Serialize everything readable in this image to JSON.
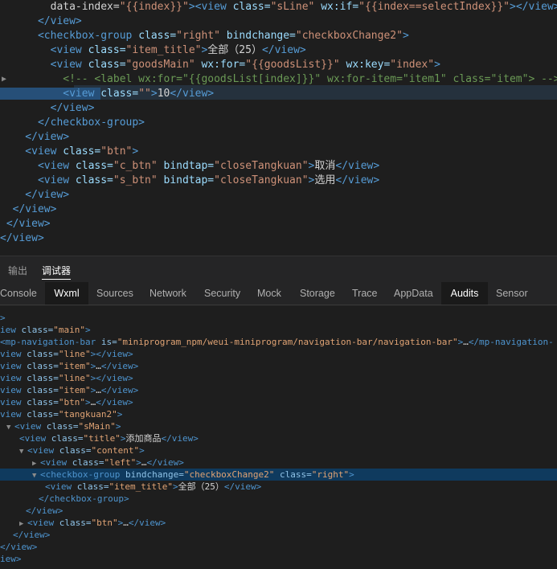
{
  "editor": {
    "lines": [
      [
        [
          "txt",
          "        data-index="
        ],
        [
          "val",
          "\"{{index}}\""
        ],
        [
          "tag",
          "><view "
        ],
        [
          "attr",
          "class="
        ],
        [
          "val",
          "\"sLine\""
        ],
        [
          "attr",
          " wx:if="
        ],
        [
          "val",
          "\"{{index==selectIndex}}\""
        ],
        [
          "tag",
          "></view>"
        ]
      ],
      [
        [
          "tag",
          "      </view>"
        ]
      ],
      [
        [
          "tag",
          "      <checkbox-group "
        ],
        [
          "attr",
          "class="
        ],
        [
          "val",
          "\"right\""
        ],
        [
          "attr",
          " bindchange="
        ],
        [
          "val",
          "\"checkboxChange2\""
        ],
        [
          "tag",
          ">"
        ]
      ],
      [
        [
          "tag",
          "        <view "
        ],
        [
          "attr",
          "class="
        ],
        [
          "val",
          "\"item_title\""
        ],
        [
          "tag",
          ">"
        ],
        [
          "txt",
          "全部（25）"
        ],
        [
          "tag",
          "</view>"
        ]
      ],
      [
        [
          "tag",
          "        <view "
        ],
        [
          "attr",
          "class="
        ],
        [
          "val",
          "\"goodsMain\""
        ],
        [
          "attr",
          " wx:for="
        ],
        [
          "val",
          "\"{{goodsList}}\""
        ],
        [
          "attr",
          " wx:key="
        ],
        [
          "val",
          "\"index\""
        ],
        [
          "tag",
          ">"
        ]
      ],
      [
        [
          "cmt",
          "          <!-- <label wx:for=\"{{goodsList[index]}}\" wx:for-item=\"item1\" class=\"item\"> -->"
        ]
      ],
      [
        [
          "tag",
          "          <view "
        ],
        [
          "attr",
          "class="
        ],
        [
          "val",
          "\"\""
        ],
        [
          "tag",
          ">"
        ],
        [
          "txt",
          "10"
        ],
        [
          "tag",
          "</view>"
        ]
      ],
      [
        [
          "tag",
          "        </view>"
        ]
      ],
      [
        [
          "tag",
          "      </checkbox-group>"
        ]
      ],
      [
        [
          "tag",
          "    </view>"
        ]
      ],
      [
        [
          "tag",
          "    <view "
        ],
        [
          "attr",
          "class="
        ],
        [
          "val",
          "\"btn\""
        ],
        [
          "tag",
          ">"
        ]
      ],
      [
        [
          "tag",
          "      <view "
        ],
        [
          "attr",
          "class="
        ],
        [
          "val",
          "\"c_btn\""
        ],
        [
          "attr",
          " bindtap="
        ],
        [
          "val",
          "\"closeTangkuan\""
        ],
        [
          "tag",
          ">"
        ],
        [
          "txt",
          "取消"
        ],
        [
          "tag",
          "</view>"
        ]
      ],
      [
        [
          "tag",
          "      <view "
        ],
        [
          "attr",
          "class="
        ],
        [
          "val",
          "\"s_btn\""
        ],
        [
          "attr",
          " bindtap="
        ],
        [
          "val",
          "\"closeTangkuan\""
        ],
        [
          "tag",
          ">"
        ],
        [
          "txt",
          "选用"
        ],
        [
          "tag",
          "</view>"
        ]
      ],
      [
        [
          "tag",
          "    </view>"
        ]
      ],
      [
        [
          "tag",
          "  </view>"
        ]
      ],
      [
        [
          "tag",
          " </view>"
        ]
      ],
      [
        [
          "tag",
          "</view>"
        ]
      ]
    ]
  },
  "panel_tabs": [
    "输出",
    "调试器"
  ],
  "dev_tabs": [
    "Console",
    "Wxml",
    "Sources",
    "Network",
    "Security",
    "Mock",
    "Storage",
    "Trace",
    "AppData",
    "Audits",
    "Sensor"
  ],
  "tree": [
    {
      "arrow": "",
      "parts": [
        [
          "ttag",
          ">"
        ]
      ]
    },
    {
      "arrow": "",
      "parts": [
        [
          "ttag",
          "iew "
        ],
        [
          "tattr",
          "class="
        ],
        [
          "tval",
          "\"main\""
        ],
        [
          "ttag",
          ">"
        ]
      ]
    },
    {
      "arrow": "",
      "parts": [
        [
          "ttag",
          "<mp-navigation-bar "
        ],
        [
          "tattr",
          "is="
        ],
        [
          "tval",
          "\"miniprogram_npm/weui-miniprogram/navigation-bar/navigation-bar\""
        ],
        [
          "ttag",
          ">"
        ],
        [
          "ell",
          "…"
        ],
        [
          "ttag",
          "</mp-navigation-"
        ]
      ]
    },
    {
      "arrow": "",
      "parts": [
        [
          "ttag",
          "view "
        ],
        [
          "tattr",
          "class="
        ],
        [
          "tval",
          "\"line\""
        ],
        [
          "ttag",
          "></view>"
        ]
      ]
    },
    {
      "arrow": "",
      "parts": [
        [
          "ttag",
          "view "
        ],
        [
          "tattr",
          "class="
        ],
        [
          "tval",
          "\"item\""
        ],
        [
          "ttag",
          ">"
        ],
        [
          "ell",
          "…"
        ],
        [
          "ttag",
          "</view>"
        ]
      ]
    },
    {
      "arrow": "",
      "parts": [
        [
          "ttag",
          "view "
        ],
        [
          "tattr",
          "class="
        ],
        [
          "tval",
          "\"line\""
        ],
        [
          "ttag",
          "></view>"
        ]
      ]
    },
    {
      "arrow": "",
      "parts": [
        [
          "ttag",
          "view "
        ],
        [
          "tattr",
          "class="
        ],
        [
          "tval",
          "\"item\""
        ],
        [
          "ttag",
          ">"
        ],
        [
          "ell",
          "…"
        ],
        [
          "ttag",
          "</view>"
        ]
      ]
    },
    {
      "arrow": "",
      "parts": [
        [
          "ttag",
          "view "
        ],
        [
          "tattr",
          "class="
        ],
        [
          "tval",
          "\"btn\""
        ],
        [
          "ttag",
          ">"
        ],
        [
          "ell",
          "…"
        ],
        [
          "ttag",
          "</view>"
        ]
      ]
    },
    {
      "arrow": "",
      "parts": [
        [
          "ttag",
          "view "
        ],
        [
          "tattr",
          "class="
        ],
        [
          "tval",
          "\"tangkuan2\""
        ],
        [
          "ttag",
          ">"
        ]
      ]
    },
    {
      "arrow": "▼",
      "parts": [
        [
          "ttag",
          "<view "
        ],
        [
          "tattr",
          "class="
        ],
        [
          "tval",
          "\"sMain\""
        ],
        [
          "ttag",
          ">"
        ]
      ]
    },
    {
      "arrow": "",
      "parts": [
        [
          "ttag",
          "<view "
        ],
        [
          "tattr",
          "class="
        ],
        [
          "tval",
          "\"title\""
        ],
        [
          "ttag",
          ">"
        ],
        [
          "ttext",
          "添加商品"
        ],
        [
          "ttag",
          "</view>"
        ]
      ]
    },
    {
      "arrow": "▼",
      "parts": [
        [
          "ttag",
          "<view "
        ],
        [
          "tattr",
          "class="
        ],
        [
          "tval",
          "\"content\""
        ],
        [
          "ttag",
          ">"
        ]
      ]
    },
    {
      "arrow": "▶",
      "parts": [
        [
          "ttag",
          "<view "
        ],
        [
          "tattr",
          "class="
        ],
        [
          "tval",
          "\"left\""
        ],
        [
          "ttag",
          ">"
        ],
        [
          "ell",
          "…"
        ],
        [
          "ttag",
          "</view>"
        ]
      ]
    },
    {
      "arrow": "▼",
      "parts": [
        [
          "ttag",
          "<checkbox-group "
        ],
        [
          "tattr",
          "bindchange="
        ],
        [
          "tval",
          "\"checkboxChange2\""
        ],
        [
          "tattr",
          " class="
        ],
        [
          "tval",
          "\"right\""
        ],
        [
          "ttag",
          ">"
        ]
      ],
      "selected": true
    },
    {
      "arrow": "",
      "parts": [
        [
          "ttag",
          "<view "
        ],
        [
          "tattr",
          "class="
        ],
        [
          "tval",
          "\"item_title\""
        ],
        [
          "ttag",
          ">"
        ],
        [
          "ttext",
          "全部（25）"
        ],
        [
          "ttag",
          "</view>"
        ]
      ]
    },
    {
      "arrow": "",
      "parts": [
        [
          "ttag",
          "</checkbox-group>"
        ]
      ]
    },
    {
      "arrow": "",
      "parts": [
        [
          "ttag",
          "</view>"
        ]
      ]
    },
    {
      "arrow": "▶",
      "parts": [
        [
          "ttag",
          "<view "
        ],
        [
          "tattr",
          "class="
        ],
        [
          "tval",
          "\"btn\""
        ],
        [
          "ttag",
          ">"
        ],
        [
          "ell",
          "…"
        ],
        [
          "ttag",
          "</view>"
        ]
      ]
    },
    {
      "arrow": "",
      "parts": [
        [
          "ttag",
          "</view>"
        ]
      ]
    },
    {
      "arrow": "",
      "parts": [
        [
          "ttag",
          "</view>"
        ]
      ]
    },
    {
      "arrow": "",
      "parts": [
        [
          "ttag",
          "iew>"
        ]
      ]
    }
  ]
}
